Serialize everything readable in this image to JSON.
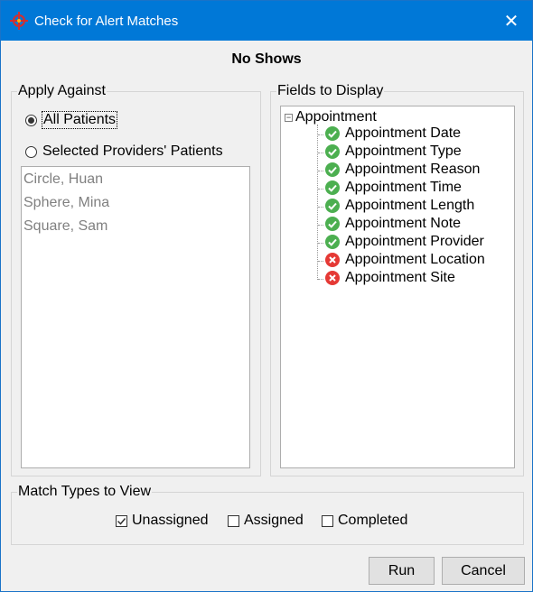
{
  "window": {
    "title": "Check for Alert Matches",
    "close_glyph": "✕"
  },
  "heading": "No Shows",
  "apply_against": {
    "legend": "Apply Against",
    "option_all": "All Patients",
    "option_selected": "Selected Providers' Patients",
    "selected_option": "all",
    "providers": [
      "Circle, Huan",
      "Sphere, Mina",
      "Square, Sam"
    ]
  },
  "fields_to_display": {
    "legend": "Fields to Display",
    "root": "Appointment",
    "expander_glyph": "−",
    "items": [
      {
        "label": "Appointment Date",
        "status": "included"
      },
      {
        "label": "Appointment Type",
        "status": "included"
      },
      {
        "label": "Appointment Reason",
        "status": "included"
      },
      {
        "label": "Appointment Time",
        "status": "included"
      },
      {
        "label": "Appointment Length",
        "status": "included"
      },
      {
        "label": "Appointment Note",
        "status": "included"
      },
      {
        "label": "Appointment Provider",
        "status": "included"
      },
      {
        "label": "Appointment Location",
        "status": "excluded"
      },
      {
        "label": "Appointment Site",
        "status": "excluded"
      }
    ]
  },
  "match_types": {
    "legend": "Match Types to View",
    "options": [
      {
        "label": "Unassigned",
        "checked": true
      },
      {
        "label": "Assigned",
        "checked": false
      },
      {
        "label": "Completed",
        "checked": false
      }
    ]
  },
  "buttons": {
    "run": "Run",
    "cancel": "Cancel"
  },
  "colors": {
    "titlebar": "#0078d7",
    "included": "#4caf50",
    "excluded": "#e53935"
  }
}
